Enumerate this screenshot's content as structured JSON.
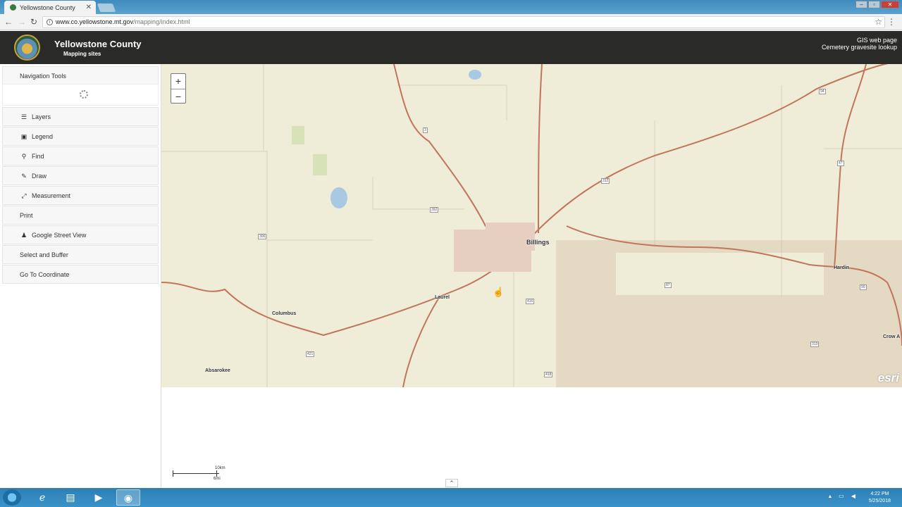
{
  "browser": {
    "tab_title": "Yellowstone County",
    "url_host": "www.co.yellowstone.mt.gov",
    "url_path": "/mapping/index.html"
  },
  "header": {
    "title": "Yellowstone County",
    "subtitle": "Mapping sites",
    "links": [
      "GIS web page",
      "Cemetery gravesite lookup"
    ]
  },
  "sidebar": {
    "nav_tools": "Navigation Tools",
    "items": [
      {
        "label": "Layers",
        "icon": "list-icon"
      },
      {
        "label": "Legend",
        "icon": "image-icon"
      },
      {
        "label": "Find",
        "icon": "search-icon"
      },
      {
        "label": "Draw",
        "icon": "brush-icon"
      },
      {
        "label": "Measurement",
        "icon": "ruler-icon"
      },
      {
        "label": "Print",
        "icon": ""
      },
      {
        "label": "Google Street View",
        "icon": "pegman-icon"
      },
      {
        "label": "Select and Buffer",
        "icon": ""
      },
      {
        "label": "Go To Coordinate",
        "icon": ""
      }
    ]
  },
  "map": {
    "zoom_in": "+",
    "zoom_out": "−",
    "places": [
      "Billings",
      "Laurel",
      "Columbus",
      "Absarokee",
      "Hardin",
      "Crow A"
    ],
    "shields": [
      "3",
      "312",
      "392",
      "306",
      "87",
      "416",
      "421",
      "418",
      "313",
      "47",
      "94",
      "90"
    ],
    "attribution": "esri",
    "scale_km": "10km",
    "scale_mi": "6mi"
  },
  "taskbar": {
    "time": "4:22 PM",
    "date": "5/25/2018"
  },
  "colors": {
    "header_bg": "#2a2a28",
    "map_bg": "#efecd7",
    "road": "#c0765c",
    "taskbar": "#2d7fb5"
  }
}
